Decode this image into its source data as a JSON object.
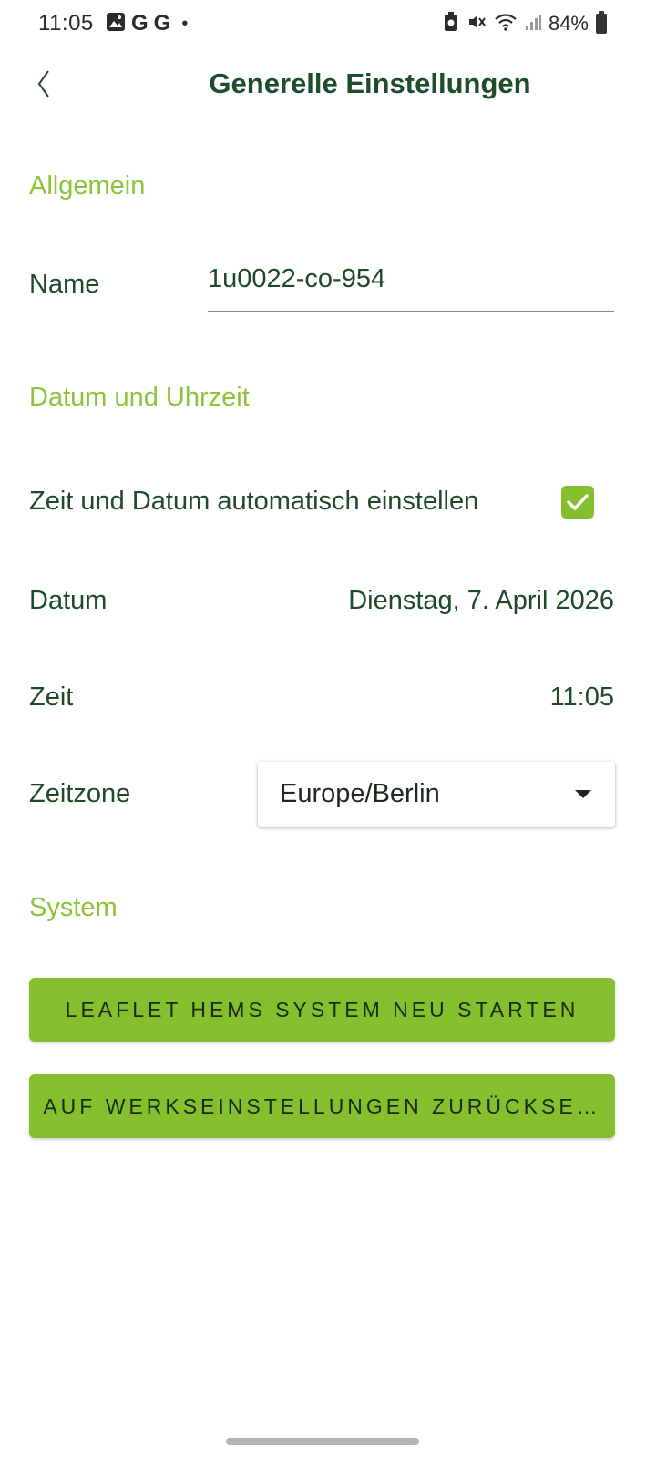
{
  "status_bar": {
    "time": "11:05",
    "notif_g1": "G",
    "notif_g2": "G",
    "notif_dot": "•",
    "battery_pct": "84%"
  },
  "header": {
    "title": "Generelle Einstellungen"
  },
  "sections": {
    "general": "Allgemein",
    "datetime": "Datum und Uhrzeit",
    "system": "System"
  },
  "name": {
    "label": "Name",
    "value": "1u0022-co-954"
  },
  "auto_time": {
    "label": "Zeit und Datum automatisch einstellen",
    "checked": true
  },
  "date": {
    "label": "Datum",
    "value": "Dienstag, 7. April 2026"
  },
  "time": {
    "label": "Zeit",
    "value": "11:05"
  },
  "timezone": {
    "label": "Zeitzone",
    "value": "Europe/Berlin"
  },
  "buttons": {
    "restart": "LEAFLET HEMS SYSTEM NEU STARTEN",
    "factory_reset": "AUF WERKSEINSTELLUNGEN ZURÜCKSE…"
  },
  "colors": {
    "accent_green": "#86bf2e",
    "section_green": "#8cc43a",
    "title_dark_green": "#1e4d2b"
  }
}
